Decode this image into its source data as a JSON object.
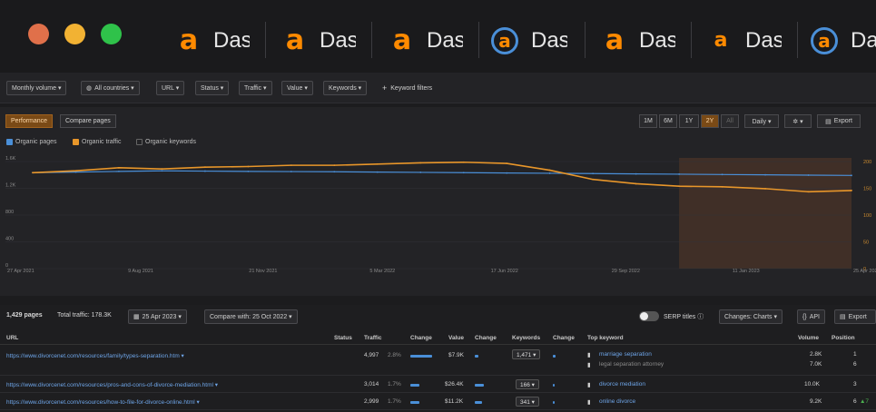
{
  "browser": {
    "tabs": [
      {
        "logo": "a",
        "label": "Das"
      },
      {
        "logo": "a",
        "label": "Das"
      },
      {
        "logo": "a",
        "label": "Das"
      },
      {
        "logo": "a",
        "label": "Das"
      },
      {
        "logo": "a",
        "label": "Das"
      },
      {
        "logo": "a",
        "label": "Das"
      },
      {
        "logo": "a",
        "label": "Das"
      }
    ],
    "colors": {
      "close": "#e0704a",
      "minimize": "#f2b233",
      "zoom": "#2fc24a",
      "brand": "#ff8a00"
    }
  },
  "filters": {
    "monthly_volume": "Monthly volume ▾",
    "countries": "All countries ▾",
    "url": "URL ▾",
    "status": "Status ▾",
    "traffic": "Traffic ▾",
    "value": "Value ▾",
    "keywords": "Keywords ▾",
    "keyword_filters": "Keyword filters"
  },
  "chart_panel": {
    "tab_performance": "Performance",
    "tab_compare": "Compare pages",
    "ranges": [
      "1M",
      "6M",
      "1Y",
      "2Y",
      "All"
    ],
    "active_range": "2Y",
    "interval": "Daily ▾",
    "settings": "▾",
    "export": "Export",
    "legend": {
      "organic_pages": "Organic pages",
      "organic_traffic": "Organic traffic",
      "organic_keywords": "Organic keywords"
    }
  },
  "chart_data": {
    "type": "line",
    "x_tick_labels": [
      "27 Apr 2021",
      "9 Aug 2021",
      "21 Nov 2021",
      "5 Mar 2022",
      "17 Jun 2022",
      "29 Sep 2022",
      "11 Jan 2023",
      "25 Apr 2023"
    ],
    "y_left_tick_labels": [
      "1.6K",
      "1.2K",
      "800",
      "400",
      "0"
    ],
    "y_right_tick_labels": [
      "200",
      "150",
      "100",
      "50",
      "0"
    ],
    "series": [
      {
        "name": "Organic pages",
        "color": "#4a8fd8",
        "values": [
          1560,
          1570,
          1580,
          1590,
          1585,
          1580,
          1578,
          1575,
          1570,
          1565,
          1560,
          1555,
          1550,
          1545,
          1540,
          1535,
          1530,
          1525,
          1520,
          1515
        ]
      },
      {
        "name": "Organic traffic",
        "color": "#e8962a",
        "values": [
          1560,
          1590,
          1640,
          1620,
          1650,
          1660,
          1680,
          1680,
          1700,
          1720,
          1730,
          1710,
          1600,
          1450,
          1380,
          1340,
          1330,
          1300,
          1250,
          1270
        ]
      }
    ],
    "ylim": [
      0,
      1800
    ],
    "highlight_range": [
      15,
      19
    ],
    "grid": true
  },
  "table": {
    "pages_count": "1,429 pages",
    "total_traffic": "Total traffic: 178.3K",
    "date": "25 Apr 2023 ▾",
    "compare": "Compare with: 25 Oct 2022 ▾",
    "serp_titles": "SERP titles",
    "changes": "Changes: Charts ▾",
    "api": "API",
    "export": "Export",
    "headers": {
      "url": "URL",
      "status": "Status",
      "traffic": "Traffic",
      "change": "Change",
      "value": "Value",
      "change2": "Change",
      "keywords": "Keywords",
      "change3": "Change",
      "top_keyword": "Top keyword",
      "volume": "Volume",
      "position": "Position"
    },
    "rows": [
      {
        "url": "https://www.divorcenet.com/resources/family/types-separation.htm ▾",
        "traffic": "4,997",
        "traffic_pct": "2.8%",
        "traffic_bar": 0.85,
        "value": "$7.9K",
        "value_bar": 0.15,
        "keywords": "1,471 ▾",
        "keywords_bar": 0.1,
        "top_keyword": "marriage separation",
        "top_keyword_2": "legal separation attorney",
        "volume": "2.8K",
        "volume_2": "7.0K",
        "position": "1",
        "position_2": "6"
      },
      {
        "url": "https://www.divorcenet.com/resources/pros-and-cons-of-divorce-mediation.html ▾",
        "traffic": "3,014",
        "traffic_pct": "1.7%",
        "traffic_bar": 0.35,
        "value": "$26.4K",
        "value_bar": 0.35,
        "keywords": "166 ▾",
        "keywords_bar": 0.05,
        "top_keyword": "divorce mediation",
        "volume": "10.0K",
        "position": "3"
      },
      {
        "url": "https://www.divorcenet.com/resources/how-to-file-for-divorce-online.html ▾",
        "traffic": "2,999",
        "traffic_pct": "1.7%",
        "traffic_bar": 0.35,
        "value": "$11.2K",
        "value_bar": 0.3,
        "keywords": "341 ▾",
        "keywords_bar": 0.05,
        "top_keyword": "online divorce",
        "volume": "9.2K",
        "position": "6",
        "position_change": "▲7"
      }
    ]
  }
}
